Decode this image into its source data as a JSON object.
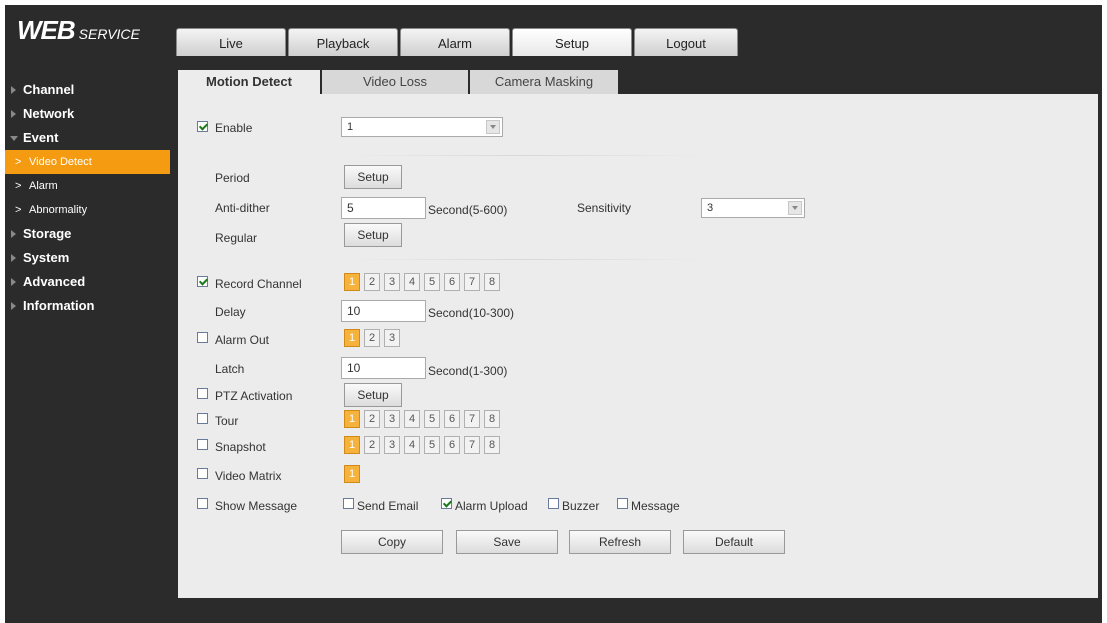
{
  "header": {
    "logo_main": "WEB",
    "logo_sub": "SERVICE"
  },
  "top_tabs": [
    {
      "label": "Live"
    },
    {
      "label": "Playback"
    },
    {
      "label": "Alarm"
    },
    {
      "label": "Setup",
      "active": true
    },
    {
      "label": "Logout"
    }
  ],
  "sidebar": {
    "items": [
      {
        "label": "Channel"
      },
      {
        "label": "Network"
      },
      {
        "label": "Event",
        "expanded": true
      },
      {
        "label": "Video Detect"
      },
      {
        "label": "Alarm"
      },
      {
        "label": "Abnormality"
      },
      {
        "label": "Storage"
      },
      {
        "label": "System"
      },
      {
        "label": "Advanced"
      },
      {
        "label": "Information"
      }
    ],
    "active": "Video Detect"
  },
  "sub_tabs": [
    {
      "label": "Motion Detect",
      "active": true
    },
    {
      "label": "Video Loss"
    },
    {
      "label": "Camera Masking"
    }
  ],
  "form": {
    "enable": {
      "label": "Enable",
      "checked": true,
      "channel_value": "1"
    },
    "period": {
      "label": "Period",
      "button": "Setup"
    },
    "anti_dither": {
      "label": "Anti-dither",
      "value": "5",
      "unit": "Second(5-600)"
    },
    "sensitivity": {
      "label": "Sensitivity",
      "value": "3"
    },
    "regular": {
      "label": "Regular",
      "button": "Setup"
    },
    "record_channel": {
      "label": "Record Channel",
      "checked": true,
      "channels": [
        "1",
        "2",
        "3",
        "4",
        "5",
        "6",
        "7",
        "8"
      ],
      "selected": [
        "1"
      ]
    },
    "delay": {
      "label": "Delay",
      "value": "10",
      "unit": "Second(10-300)"
    },
    "alarm_out": {
      "label": "Alarm Out",
      "checked": false,
      "channels": [
        "1",
        "2",
        "3"
      ],
      "selected": [
        "1"
      ]
    },
    "latch": {
      "label": "Latch",
      "value": "10",
      "unit": "Second(1-300)"
    },
    "ptz_activation": {
      "label": "PTZ Activation",
      "checked": false,
      "button": "Setup"
    },
    "tour": {
      "label": "Tour",
      "checked": false,
      "channels": [
        "1",
        "2",
        "3",
        "4",
        "5",
        "6",
        "7",
        "8"
      ],
      "selected": [
        "1"
      ]
    },
    "snapshot": {
      "label": "Snapshot",
      "checked": false,
      "channels": [
        "1",
        "2",
        "3",
        "4",
        "5",
        "6",
        "7",
        "8"
      ],
      "selected": [
        "1"
      ]
    },
    "video_matrix": {
      "label": "Video Matrix",
      "checked": false,
      "channels": [
        "1"
      ],
      "selected": [
        "1"
      ]
    },
    "show_message": {
      "label": "Show Message",
      "checked": false
    },
    "send_email": {
      "label": "Send Email",
      "checked": false
    },
    "alarm_upload": {
      "label": "Alarm Upload",
      "checked": true
    },
    "buzzer": {
      "label": "Buzzer",
      "checked": false
    },
    "message": {
      "label": "Message",
      "checked": false
    }
  },
  "actions": {
    "copy": "Copy",
    "save": "Save",
    "refresh": "Refresh",
    "default": "Default"
  },
  "colors": {
    "accent": "#f49b12",
    "background": "#2b2b2b",
    "panel": "#ececec"
  }
}
